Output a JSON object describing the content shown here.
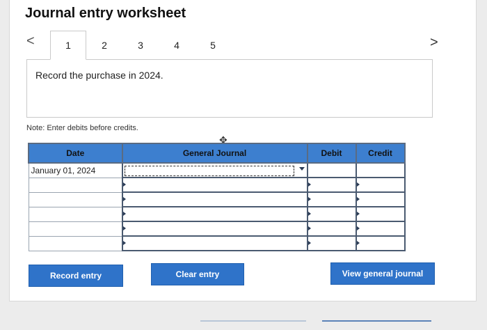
{
  "page": {
    "title": "Journal entry worksheet"
  },
  "nav": {
    "prev": "<",
    "next": ">"
  },
  "tabs": [
    {
      "label": "1",
      "active": true
    },
    {
      "label": "2",
      "active": false
    },
    {
      "label": "3",
      "active": false
    },
    {
      "label": "4",
      "active": false
    },
    {
      "label": "5",
      "active": false
    }
  ],
  "instruction": {
    "text": "Record the purchase in 2024."
  },
  "note": {
    "text": "Note: Enter debits before credits."
  },
  "table": {
    "headers": {
      "date": "Date",
      "account": "General Journal",
      "debit": "Debit",
      "credit": "Credit"
    },
    "rows": [
      {
        "date": "January 01, 2024",
        "account": "",
        "debit": "",
        "credit": ""
      },
      {
        "date": "",
        "account": "",
        "debit": "",
        "credit": ""
      },
      {
        "date": "",
        "account": "",
        "debit": "",
        "credit": ""
      },
      {
        "date": "",
        "account": "",
        "debit": "",
        "credit": ""
      },
      {
        "date": "",
        "account": "",
        "debit": "",
        "credit": ""
      },
      {
        "date": "",
        "account": "",
        "debit": "",
        "credit": ""
      }
    ]
  },
  "buttons": {
    "record": "Record entry",
    "clear": "Clear entry",
    "view": "View general journal"
  },
  "colors": {
    "accent": "#2f73c9",
    "header": "#3d7fcf"
  }
}
